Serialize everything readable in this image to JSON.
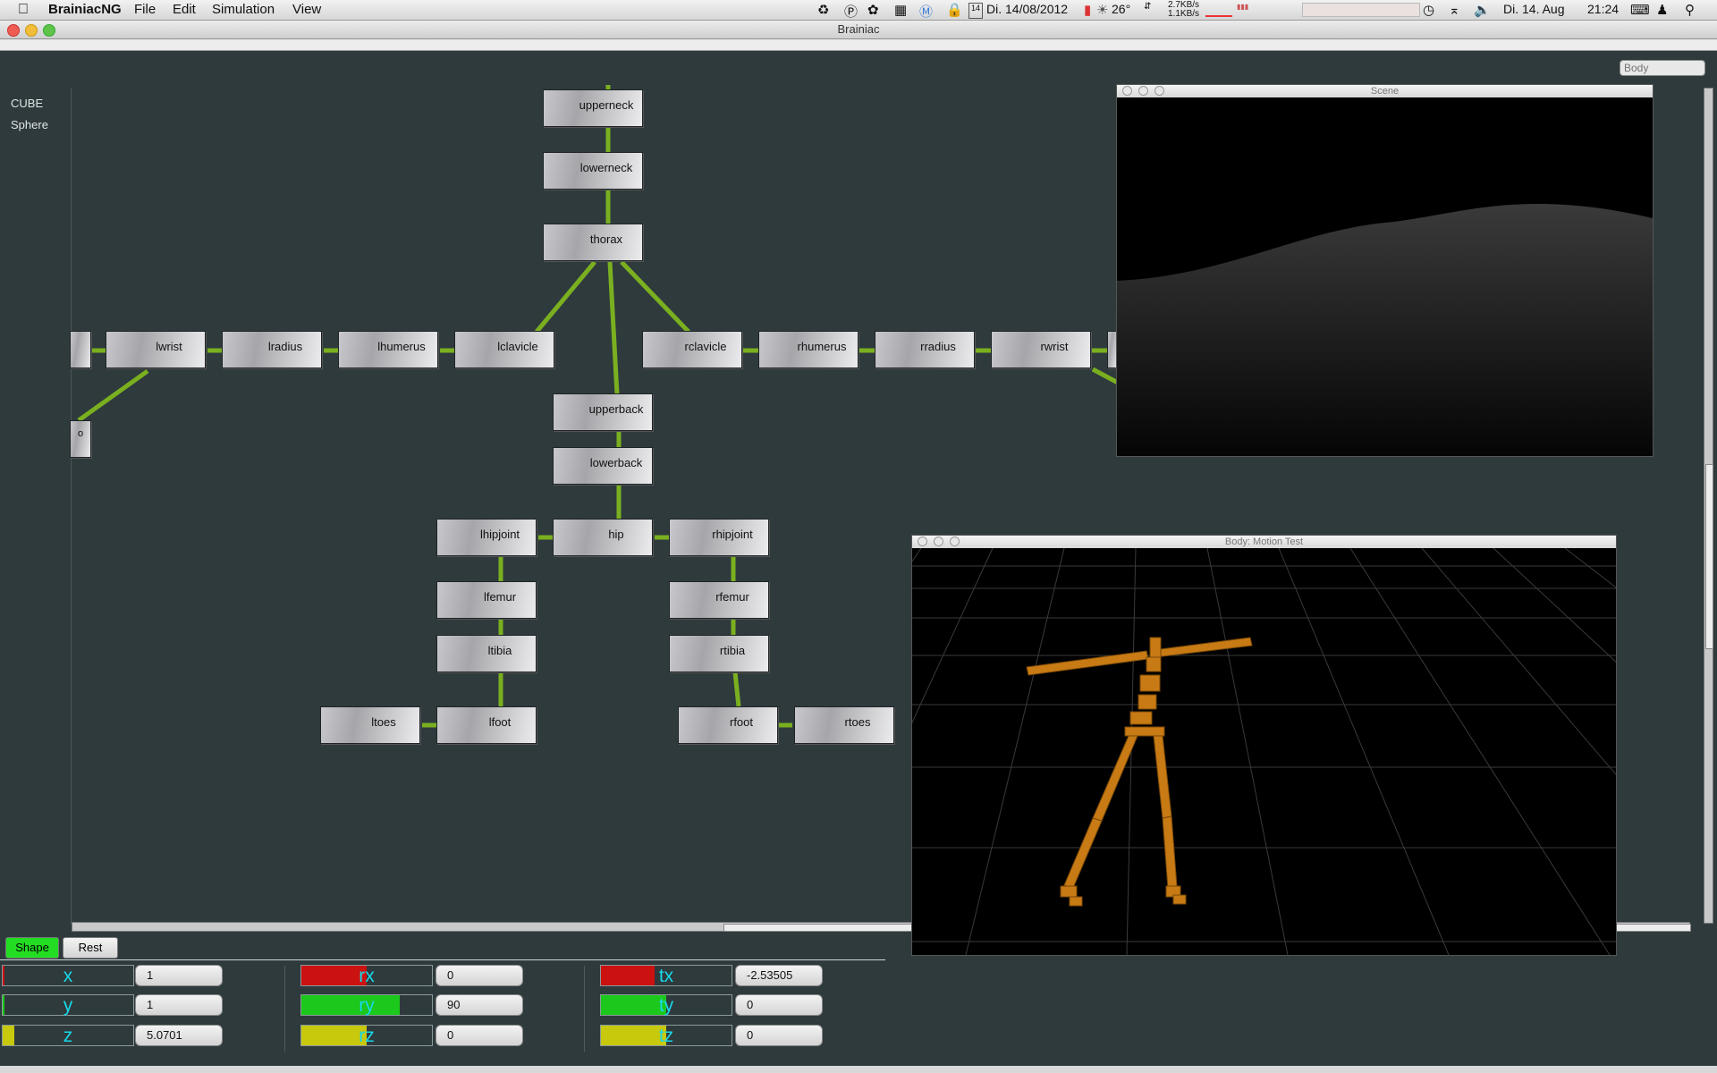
{
  "menubar": {
    "app_name": "BrainiacNG",
    "menus": [
      "File",
      "Edit",
      "Simulation",
      "View"
    ],
    "date_short": "Di. 14/08/2012",
    "calendar_day": "14",
    "temperature": "26°",
    "net_up": "2.7KB/s",
    "net_down": "1.1KB/s",
    "date_long": "Di. 14. Aug",
    "time": "21:24"
  },
  "window": {
    "title": "Brainiac"
  },
  "search": {
    "placeholder": "Body"
  },
  "leftlist": {
    "items": [
      "CUBE",
      "Sphere"
    ]
  },
  "nodes": {
    "upperneck": "upperneck",
    "lowerneck": "lowerneck",
    "thorax": "thorax",
    "lwrist": "lwrist",
    "lradius": "lradius",
    "lhumerus": "lhumerus",
    "lclavicle": "lclavicle",
    "rclavicle": "rclavicle",
    "rhumerus": "rhumerus",
    "rradius": "rradius",
    "rwrist": "rwrist",
    "upperback": "upperback",
    "lowerback": "lowerback",
    "lhipjoint": "lhipjoint",
    "hip": "hip",
    "rhipjoint": "rhipjoint",
    "lfemur": "lfemur",
    "rfemur": "rfemur",
    "ltibia": "ltibia",
    "rtibia": "rtibia",
    "ltoes": "ltoes",
    "lfoot": "lfoot",
    "rfoot": "rfoot",
    "rtoes": "rtoes",
    "partial_left": "o"
  },
  "scene_window": {
    "title": "Scene"
  },
  "motion_window": {
    "title": "Body: Motion Test"
  },
  "tabs": {
    "shape": "Shape",
    "rest": "Rest"
  },
  "params": {
    "x": {
      "label": "x",
      "value": "1",
      "level": 0.0
    },
    "y": {
      "label": "y",
      "value": "1",
      "level": 0.0
    },
    "z": {
      "label": "z",
      "value": "5.0701",
      "level": 0.09
    },
    "rx": {
      "label": "rx",
      "value": "0",
      "level": 0.5
    },
    "ry": {
      "label": "ry",
      "value": "90",
      "level": 0.75
    },
    "rz": {
      "label": "rz",
      "value": "0",
      "level": 0.5
    },
    "tx": {
      "label": "tx",
      "value": "-2.53505",
      "level": 0.41
    },
    "ty": {
      "label": "ty",
      "value": "0",
      "level": 0.5
    },
    "tz": {
      "label": "tz",
      "value": "0",
      "level": 0.5
    }
  },
  "colors": {
    "red": "#cc1111",
    "green": "#1bc81b",
    "yellow": "#c8c80c",
    "edge": "#7ab020",
    "tab_active": "#22dd22"
  }
}
